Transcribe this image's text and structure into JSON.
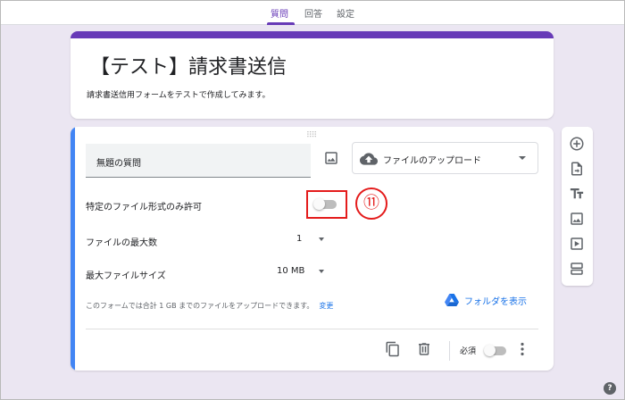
{
  "tabs": [
    {
      "label": "質問",
      "active": true
    },
    {
      "label": "回答",
      "active": false
    },
    {
      "label": "設定",
      "active": false
    }
  ],
  "form": {
    "title": "【テスト】請求書送信",
    "description": "請求書送信用フォームをテストで作成してみます。"
  },
  "question": {
    "title": "無題の質問",
    "type_label": "ファイルのアップロード",
    "type_icon": "cloud-upload-icon",
    "settings": {
      "specific_types_label": "特定のファイル形式のみ許可",
      "specific_types_enabled": false,
      "max_files_label": "ファイルの最大数",
      "max_files_value": "1",
      "max_size_label": "最大ファイルサイズ",
      "max_size_value": "10 MB"
    },
    "upload_note": "このフォームでは合計 1 GB までのファイルをアップロードできます。",
    "change_link": "変更",
    "folder_link": "フォルダを表示",
    "required_label": "必須",
    "required_enabled": false
  },
  "annotation": {
    "step_number": "⑪",
    "color": "#e41b1b"
  },
  "toolbar_icons": [
    "add-question-icon",
    "import-questions-icon",
    "add-title-icon",
    "add-image-icon",
    "add-video-icon",
    "add-section-icon"
  ],
  "colors": {
    "accent": "#673ab7",
    "background": "#ebe6f2",
    "active_question_border": "#4285f4",
    "link": "#1a73e8"
  }
}
